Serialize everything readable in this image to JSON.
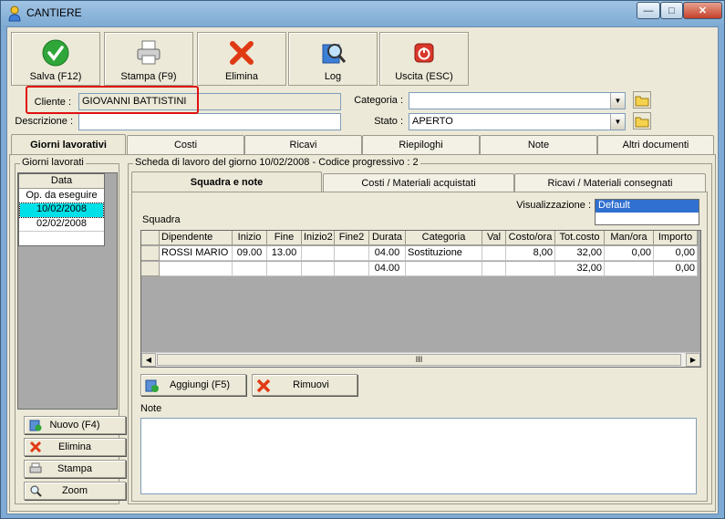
{
  "window": {
    "title": "CANTIERE",
    "minimize_icon": "minimize-icon",
    "maximize_icon": "maximize-icon",
    "close_icon": "close-icon"
  },
  "toolbar": {
    "save": {
      "label": "Salva (F12)",
      "icon": "check-icon",
      "color": "#2fa63a"
    },
    "print": {
      "label": "Stampa (F9)",
      "icon": "printer-icon"
    },
    "delete": {
      "label": "Elimina",
      "icon": "red-x-icon",
      "color": "#e03a14"
    },
    "log": {
      "label": "Log",
      "icon": "magnifier-icon"
    },
    "exit": {
      "label": "Uscita (ESC)",
      "icon": "power-icon",
      "color": "#d9372a"
    }
  },
  "form": {
    "cliente_label": "Cliente :",
    "cliente_value": "GIOVANNI BATTISTINI",
    "descrizione_label": "Descrizione :",
    "descrizione_value": "",
    "categoria_label": "Categoria :",
    "categoria_value": "",
    "stato_label": "Stato :",
    "stato_value": "APERTO"
  },
  "tabs": [
    "Giorni lavorativi",
    "Costi",
    "Ricavi",
    "Riepiloghi",
    "Note",
    "Altri documenti"
  ],
  "giorni": {
    "group_title": "Giorni lavorati",
    "list_header": "Data",
    "items": [
      "Op. da eseguire",
      "10/02/2008",
      "02/02/2008"
    ],
    "selected": "10/02/2008",
    "buttons": {
      "nuovo": "Nuovo (F4)",
      "elimina": "Elimina",
      "stampa": "Stampa",
      "zoom": "Zoom"
    }
  },
  "scheda": {
    "title": "Scheda di lavoro del giorno 10/02/2008 - Codice progressivo : 2",
    "subtabs": [
      "Squadra e note",
      "Costi / Materiali acquistati",
      "Ricavi / Materiali consegnati"
    ],
    "visualizzazione_label": "Visualizzazione :",
    "visualizzazione_value": "Default",
    "squadra_label": "Squadra",
    "columns": [
      "Dipendente",
      "Inizio",
      "Fine",
      "Inizio2",
      "Fine2",
      "Durata",
      "Categoria",
      "Val",
      "Costo/ora",
      "Tot.costo",
      "Man/ora",
      "Importo"
    ],
    "rows": [
      [
        "ROSSI MARIO",
        "09.00",
        "13.00",
        "",
        "",
        "04.00",
        "Sostituzione",
        "",
        "8,00",
        "32,00",
        "0,00",
        "0,00"
      ],
      [
        "",
        "",
        "",
        "",
        "",
        "04.00",
        "",
        "",
        "",
        "32,00",
        "",
        "0,00"
      ]
    ],
    "scroll_thumb": "III",
    "aggiungi": "Aggiungi (F5)",
    "rimuovi": "Rimuovi",
    "note_label": "Note",
    "note_value": ""
  }
}
